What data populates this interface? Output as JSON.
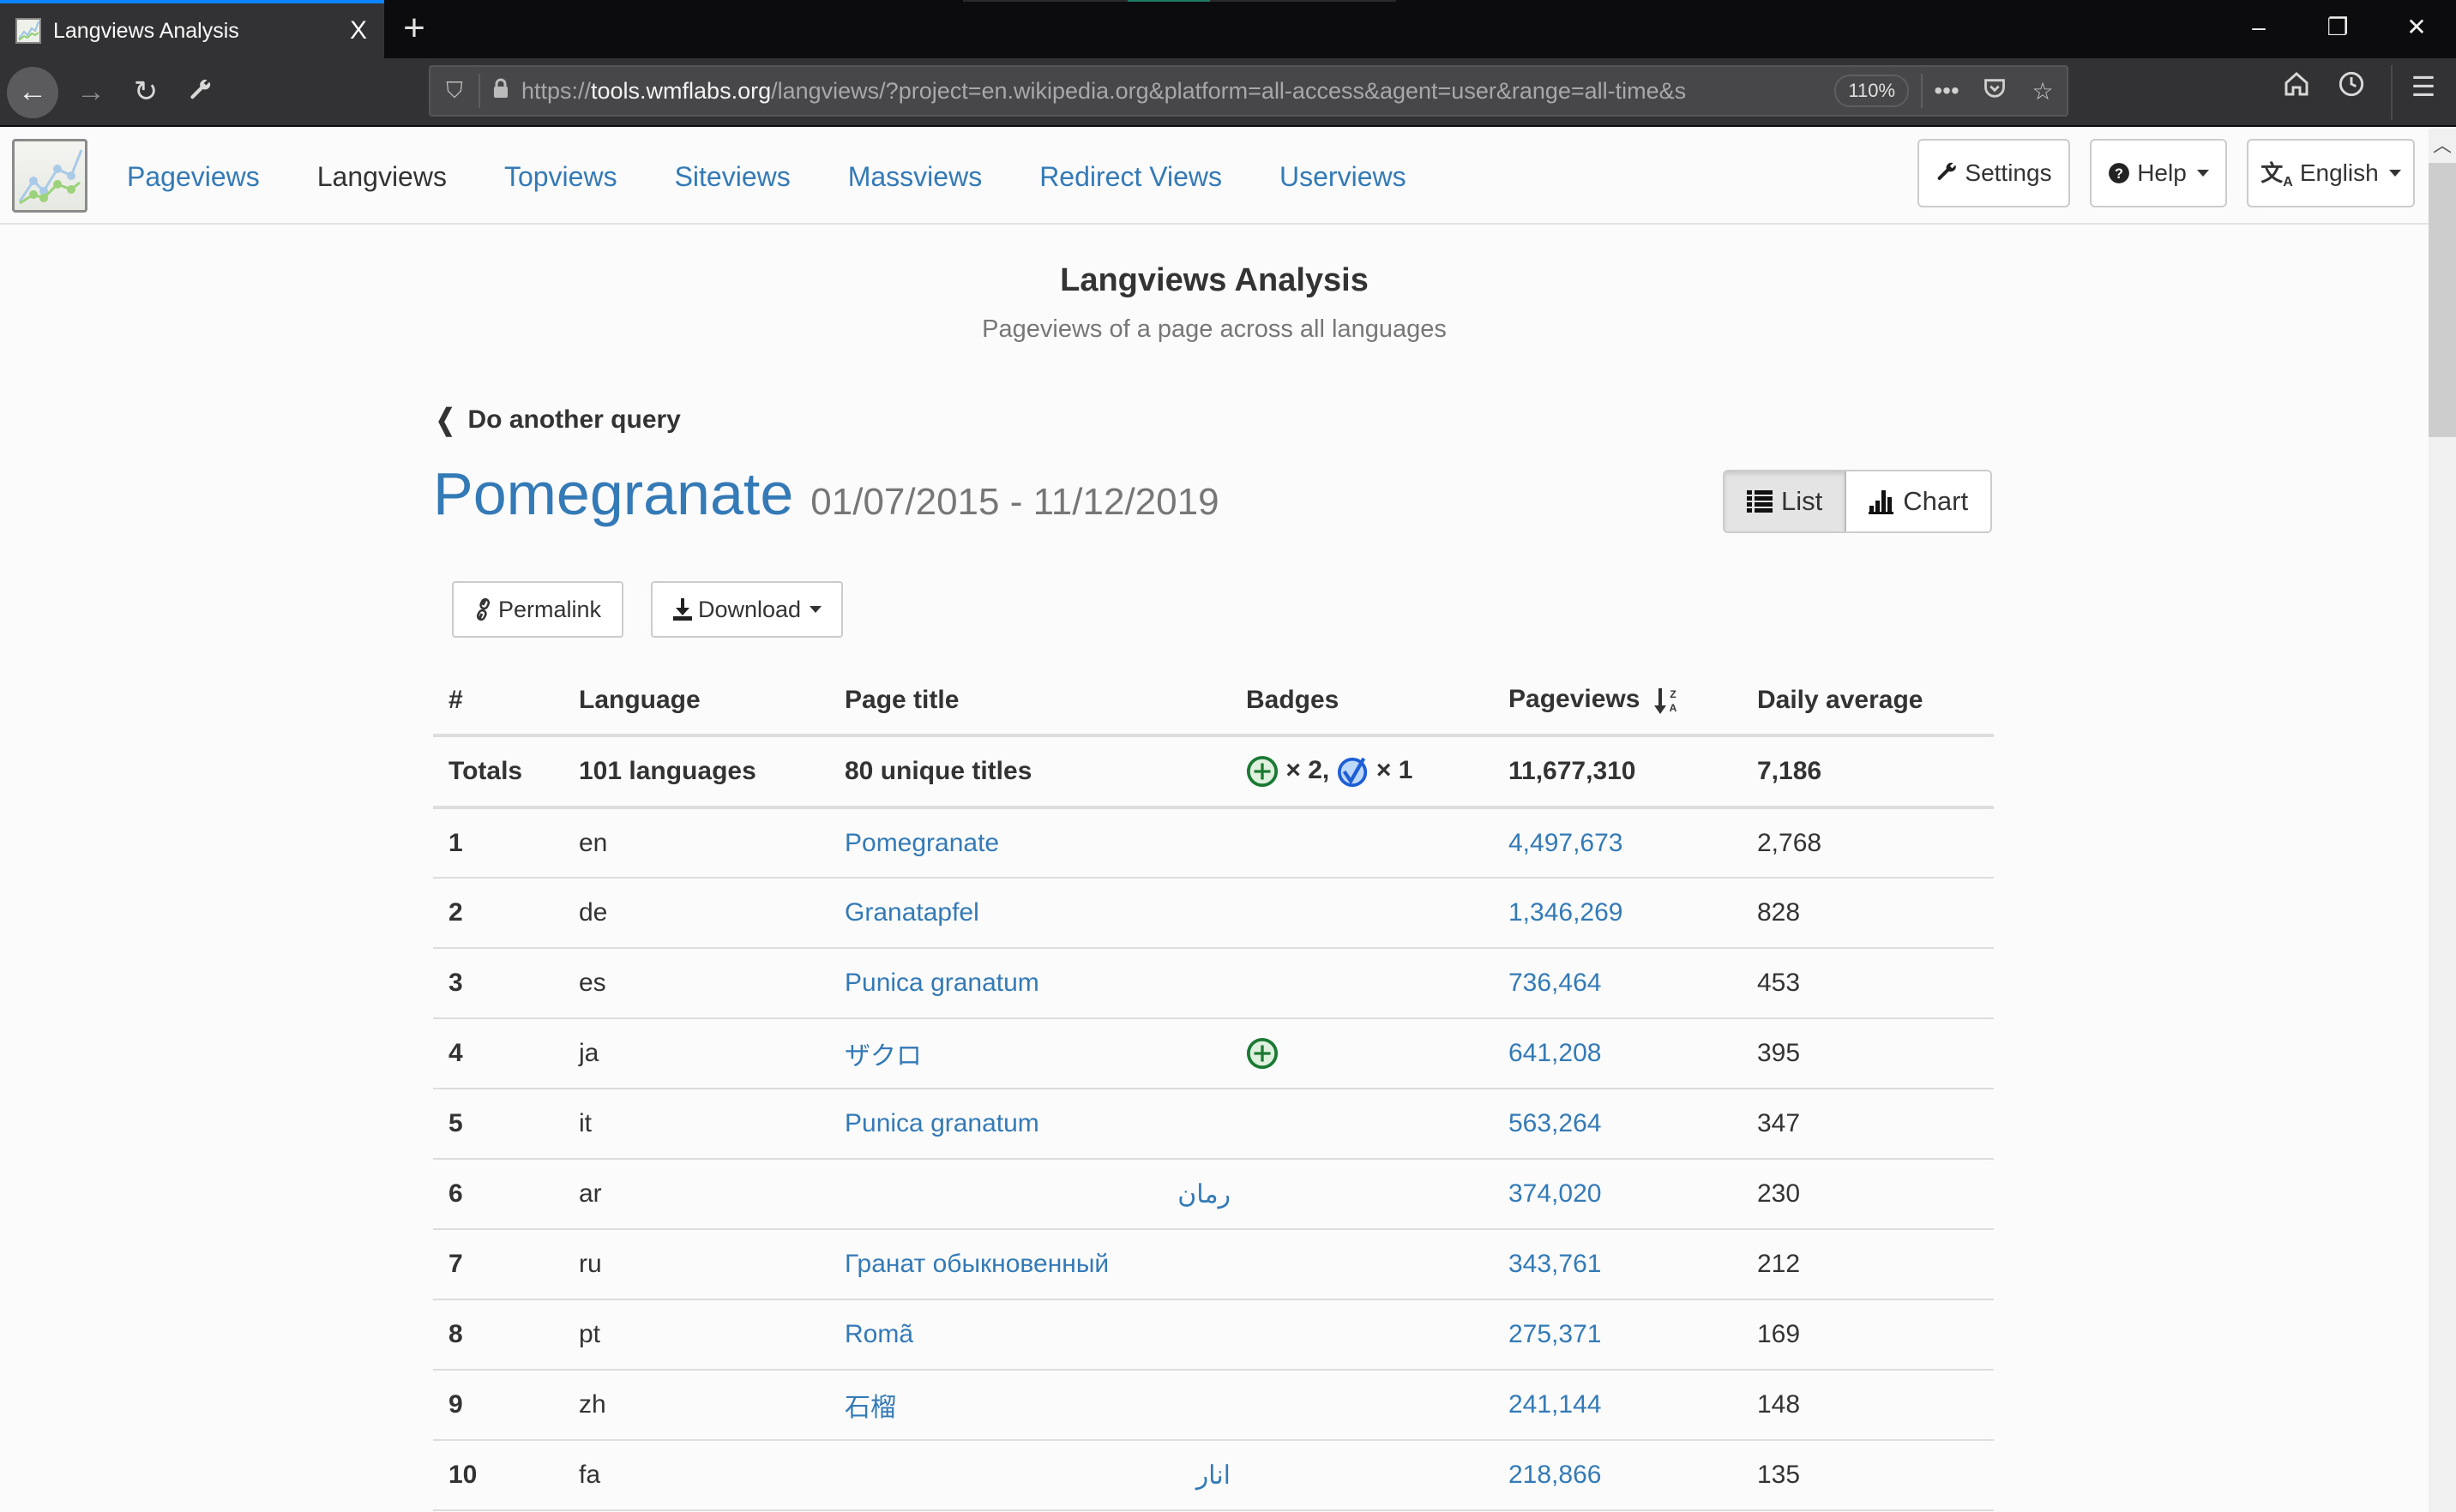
{
  "browser": {
    "tab_title": "Langviews Analysis",
    "url_prefix": "https://",
    "url_host": "tools.wmflabs.org",
    "url_rest": "/langviews/?project=en.wikipedia.org&platform=all-access&agent=user&range=all-time&s",
    "zoom_level": "110%",
    "new_tab_label": "+",
    "close_tab_label": "X"
  },
  "sitenav": {
    "links": [
      {
        "label": "Pageviews",
        "active": false
      },
      {
        "label": "Langviews",
        "active": true
      },
      {
        "label": "Topviews",
        "active": false
      },
      {
        "label": "Siteviews",
        "active": false
      },
      {
        "label": "Massviews",
        "active": false
      },
      {
        "label": "Redirect Views",
        "active": false
      },
      {
        "label": "Userviews",
        "active": false
      }
    ],
    "settings_label": "Settings",
    "help_label": "Help",
    "language_label": "English"
  },
  "header": {
    "title": "Langviews Analysis",
    "subtitle": "Pageviews of a page across all languages"
  },
  "query": {
    "back_label": "Do another query",
    "page_name": "Pomegranate",
    "date_range": "01/07/2015 - 11/12/2019",
    "view_list_label": "List",
    "view_chart_label": "Chart",
    "active_view": "List",
    "permalink_label": "Permalink",
    "download_label": "Download"
  },
  "table": {
    "columns": [
      "#",
      "Language",
      "Page title",
      "Badges",
      "Pageviews",
      "Daily average"
    ],
    "sorted_by": "Pageviews",
    "sort_direction": "descending",
    "totals": {
      "label": "Totals",
      "languages": "101 languages",
      "titles": "80 unique titles",
      "badge_featured_count": "× 2,",
      "badge_good_count": "× 1",
      "pageviews": "11,677,310",
      "daily_average": "7,186"
    },
    "rows": [
      {
        "rank": "1",
        "lang": "en",
        "title": "Pomegranate",
        "badge": "",
        "pageviews": "4,497,673",
        "daily_average": "2,768"
      },
      {
        "rank": "2",
        "lang": "de",
        "title": "Granatapfel",
        "badge": "",
        "pageviews": "1,346,269",
        "daily_average": "828"
      },
      {
        "rank": "3",
        "lang": "es",
        "title": "Punica granatum",
        "badge": "",
        "pageviews": "736,464",
        "daily_average": "453"
      },
      {
        "rank": "4",
        "lang": "ja",
        "title": "ザクロ",
        "badge": "featured",
        "pageviews": "641,208",
        "daily_average": "395"
      },
      {
        "rank": "5",
        "lang": "it",
        "title": "Punica granatum",
        "badge": "",
        "pageviews": "563,264",
        "daily_average": "347"
      },
      {
        "rank": "6",
        "lang": "ar",
        "title": "رمان",
        "badge": "",
        "pageviews": "374,020",
        "daily_average": "230"
      },
      {
        "rank": "7",
        "lang": "ru",
        "title": "Гранат обыкновенный",
        "badge": "",
        "pageviews": "343,761",
        "daily_average": "212"
      },
      {
        "rank": "8",
        "lang": "pt",
        "title": "Romã",
        "badge": "",
        "pageviews": "275,371",
        "daily_average": "169"
      },
      {
        "rank": "9",
        "lang": "zh",
        "title": "石榴",
        "badge": "",
        "pageviews": "241,144",
        "daily_average": "148"
      },
      {
        "rank": "10",
        "lang": "fa",
        "title": "انار",
        "badge": "",
        "pageviews": "218,866",
        "daily_average": "135"
      }
    ]
  },
  "colors": {
    "link": "#337ab7",
    "text": "#333333",
    "muted": "#777777",
    "badge_featured": "#1a7a34",
    "badge_good": "#1f5fd6",
    "tab_accent": "#0a84ff"
  }
}
